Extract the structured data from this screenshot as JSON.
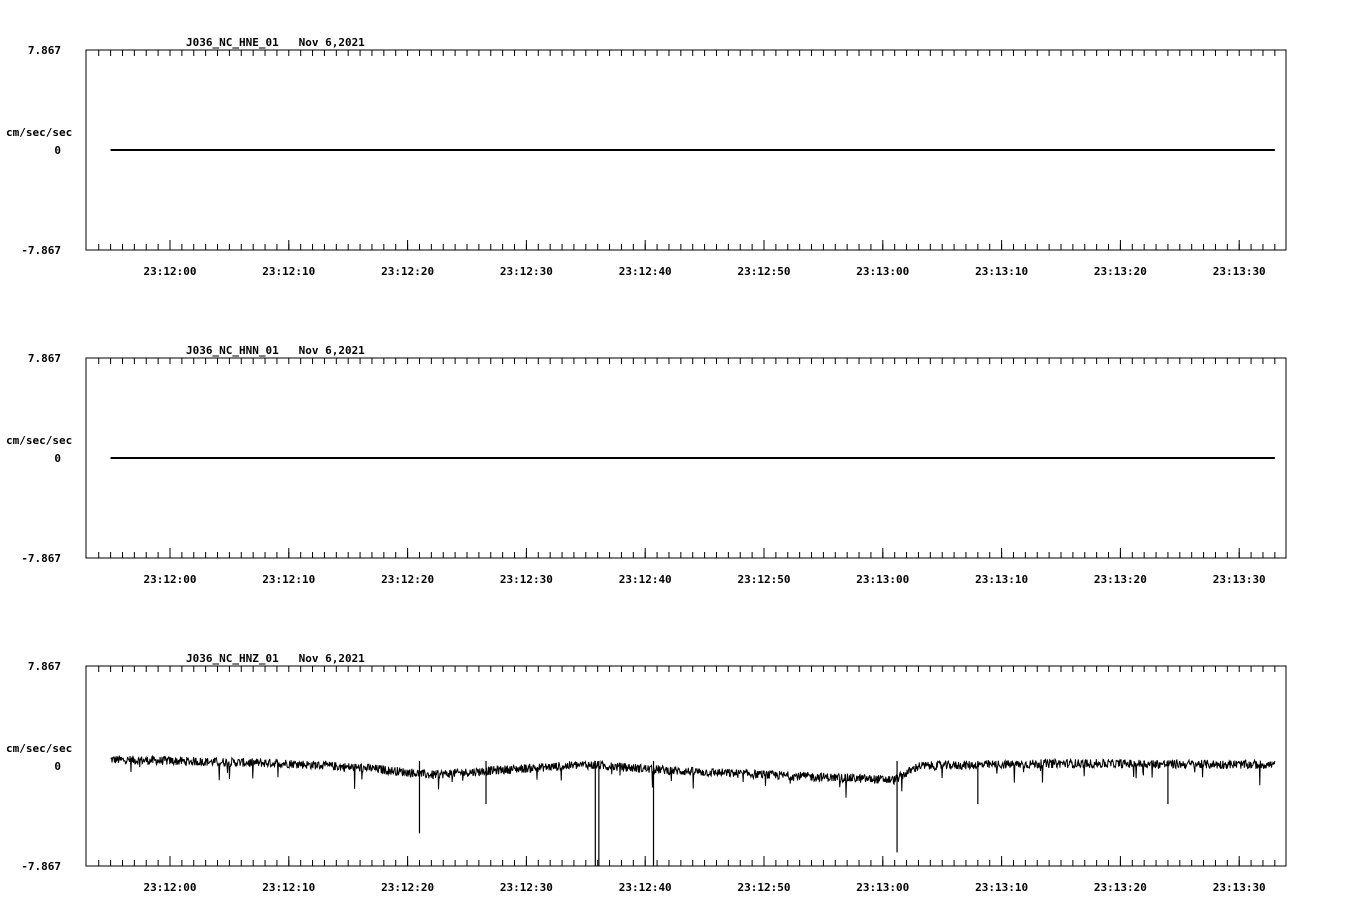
{
  "chart_data": [
    {
      "type": "line",
      "title": "J036_NC_HNE_01   Nov 6,2021",
      "ylabel": "cm/sec/sec",
      "ylim": [
        -7.867,
        7.867
      ],
      "y_ticks": [
        "7.867",
        "0",
        "-7.867"
      ],
      "x_ticks": [
        "23:12:00",
        "23:12:10",
        "23:12:20",
        "23:12:30",
        "23:12:40",
        "23:12:50",
        "23:13:00",
        "23:13:10",
        "23:13:20",
        "23:13:30"
      ],
      "series": [
        {
          "t_start": "23:11:55",
          "t_end": "23:13:33",
          "trace": "flat",
          "value": 0
        }
      ]
    },
    {
      "type": "line",
      "title": "J036_NC_HNN_01   Nov 6,2021",
      "ylabel": "cm/sec/sec",
      "ylim": [
        -7.867,
        7.867
      ],
      "y_ticks": [
        "7.867",
        "0",
        "-7.867"
      ],
      "x_ticks": [
        "23:12:00",
        "23:12:10",
        "23:12:20",
        "23:12:30",
        "23:12:40",
        "23:12:50",
        "23:13:00",
        "23:13:10",
        "23:13:20",
        "23:13:30"
      ],
      "series": [
        {
          "t_start": "23:11:55",
          "t_end": "23:13:33",
          "trace": "flat",
          "value": 0
        }
      ]
    },
    {
      "type": "line",
      "title": "J036_NC_HNZ_01   Nov 6,2021",
      "ylabel": "cm/sec/sec",
      "ylim": [
        -7.867,
        7.867
      ],
      "y_ticks": [
        "7.867",
        "0",
        "-7.867"
      ],
      "x_ticks": [
        "23:12:00",
        "23:12:10",
        "23:12:20",
        "23:12:30",
        "23:12:40",
        "23:12:50",
        "23:13:00",
        "23:13:10",
        "23:13:20",
        "23:13:30"
      ],
      "series": [
        {
          "t_start": "23:11:55",
          "t_end": "23:13:33",
          "trace": "noisy",
          "baseline": 0.5,
          "noise": 0.35,
          "envelope": [
            {
              "t": 0,
              "offset": 0.5
            },
            {
              "t": 15,
              "offset": 0.2
            },
            {
              "t": 22,
              "offset": -0.2
            },
            {
              "t": 27,
              "offset": -0.7
            },
            {
              "t": 33,
              "offset": -0.3
            },
            {
              "t": 40,
              "offset": 0.1
            },
            {
              "t": 48,
              "offset": -0.4
            },
            {
              "t": 58,
              "offset": -0.8
            },
            {
              "t": 66,
              "offset": -1.1
            },
            {
              "t": 68,
              "offset": 0.0
            },
            {
              "t": 80,
              "offset": 0.2
            },
            {
              "t": 98,
              "offset": 0.1
            }
          ],
          "spikes": [
            {
              "t": 26.0,
              "value": -5.3
            },
            {
              "t": 31.6,
              "value": -3.0
            },
            {
              "t": 40.8,
              "value": -7.867
            },
            {
              "t": 41.1,
              "value": -7.867
            },
            {
              "t": 45.7,
              "value": -7.867
            },
            {
              "t": 66.2,
              "value": -6.8
            },
            {
              "t": 73.0,
              "value": -3.0
            },
            {
              "t": 89.0,
              "value": -3.0
            }
          ]
        }
      ]
    }
  ]
}
